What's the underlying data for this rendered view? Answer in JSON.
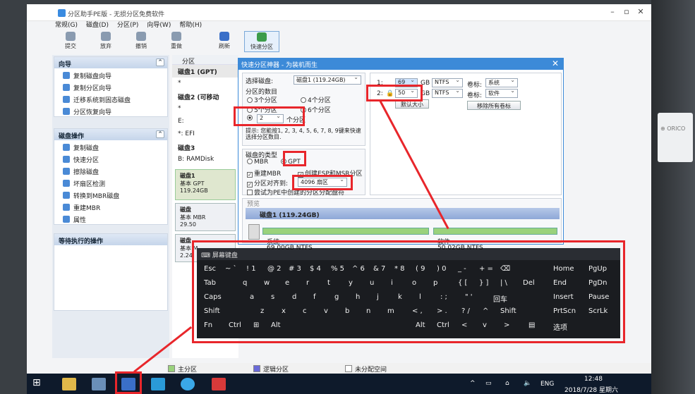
{
  "window": {
    "title": "分区助手PE版 - 无损分区免费软件"
  },
  "menu": [
    "常规(G)",
    "磁盘(D)",
    "分区(P)",
    "向导(W)",
    "帮助(H)"
  ],
  "toolbar": [
    {
      "label": "提交"
    },
    {
      "label": "放弃"
    },
    {
      "label": "撤销"
    },
    {
      "label": "重做"
    },
    {
      "label": "刷新"
    },
    {
      "label": "快速分区"
    }
  ],
  "left": {
    "wizard": {
      "title": "向导",
      "items": [
        "复制磁盘向导",
        "复制分区向导",
        "迁移系统到固态磁盘",
        "分区恢复向导"
      ]
    },
    "diskops": {
      "title": "磁盘操作",
      "items": [
        "复制磁盘",
        "快速分区",
        "擦除磁盘",
        "坏扇区检测",
        "转换到MBR磁盘",
        "重建MBR",
        "属性"
      ]
    },
    "pending": {
      "title": "等待执行的操作"
    }
  },
  "mid": {
    "header": "分区",
    "rows": [
      "磁盘1 (GPT)",
      "*",
      "磁盘2 (可移动",
      "*",
      "E:",
      "*: EFI",
      "磁盘3",
      "B: RAMDisk"
    ],
    "disk1": {
      "name": "磁盘1",
      "type": "基本 GPT",
      "size": "119.24GB"
    },
    "disk2": {
      "name": "磁盘",
      "type": "基本 MBR",
      "size": "29.50"
    },
    "disk3": {
      "name": "磁盘",
      "type": "基本 M",
      "size": "2.24"
    }
  },
  "dialog": {
    "title": "快速分区神器 - 为装机而生",
    "select_disk_label": "选择磁盘:",
    "select_disk_value": "磁盘1 (119.24GB)",
    "count_group": "分区的数目",
    "opt3": "3个分区",
    "opt4": "4个分区",
    "opt5": "5个分区",
    "opt6": "6个分区",
    "custom_count": "2",
    "custom_suffix": "个分区",
    "hint": "提示: 您能按1, 2, 3, 4, 5, 6, 7, 8, 9键来快速选择分区数目.",
    "type_group": "磁盘的类型",
    "mbr": "MBR",
    "gpt": "GPT",
    "rebuild_mbr": "重建MBR",
    "create_esp": "创建ESP和MSR分区",
    "align_label": "分区对齐到:",
    "align_value": "4096 扇区",
    "try_pe": "尝试为PE中创建的分区分配盘符",
    "p1_num": "1:",
    "p1_size": "69",
    "p1_unit": "GB",
    "p1_fs": "NTFS",
    "p1_vol_label": "卷标:",
    "p1_vol": "系统",
    "p2_num": "2:",
    "p2_size": "50",
    "p2_unit": "GB",
    "p2_fs": "NTFS",
    "p2_vol_label": "卷标:",
    "p2_vol": "软件",
    "default_btn": "默认大小",
    "clear_btn": "移除所有卷标",
    "preview": "预览",
    "preview_disk": "磁盘1 (119.24GB)",
    "pv1_name": "系统",
    "pv1_size": "69.00GB NTFS",
    "pv2_name": "软件",
    "pv2_size": "50.02GB NTFS"
  },
  "osk": {
    "title": "屏幕键盘",
    "rows": [
      [
        "Esc",
        "~ `",
        "! 1",
        "@ 2",
        "# 3",
        "$ 4",
        "% 5",
        "^ 6",
        "& 7",
        "* 8",
        "( 9",
        ") 0",
        "_ -",
        "+ =",
        "⌫",
        "Home",
        "PgUp"
      ],
      [
        "Tab",
        "q",
        "w",
        "e",
        "r",
        "t",
        "y",
        "u",
        "i",
        "o",
        "p",
        "{ [",
        "} ]",
        "| \\",
        "Del",
        "End",
        "PgDn"
      ],
      [
        "Caps",
        "a",
        "s",
        "d",
        "f",
        "g",
        "h",
        "j",
        "k",
        "l",
        ": ;",
        "\" '",
        "回车",
        "Insert",
        "Pause"
      ],
      [
        "Shift",
        "z",
        "x",
        "c",
        "v",
        "b",
        "n",
        "m",
        "< ,",
        "> .",
        "? /",
        "^",
        "Shift",
        "PrtScn",
        "ScrLk"
      ],
      [
        "Fn",
        "Ctrl",
        "⊞",
        "Alt",
        "Alt",
        "Ctrl",
        "<",
        "v",
        ">",
        "▤",
        "选项"
      ]
    ]
  },
  "legend": [
    "主分区",
    "逻辑分区",
    "未分配空间"
  ],
  "tray": {
    "lang": "ENG",
    "time": "12:48",
    "date": "2018/7/28 星期六"
  }
}
